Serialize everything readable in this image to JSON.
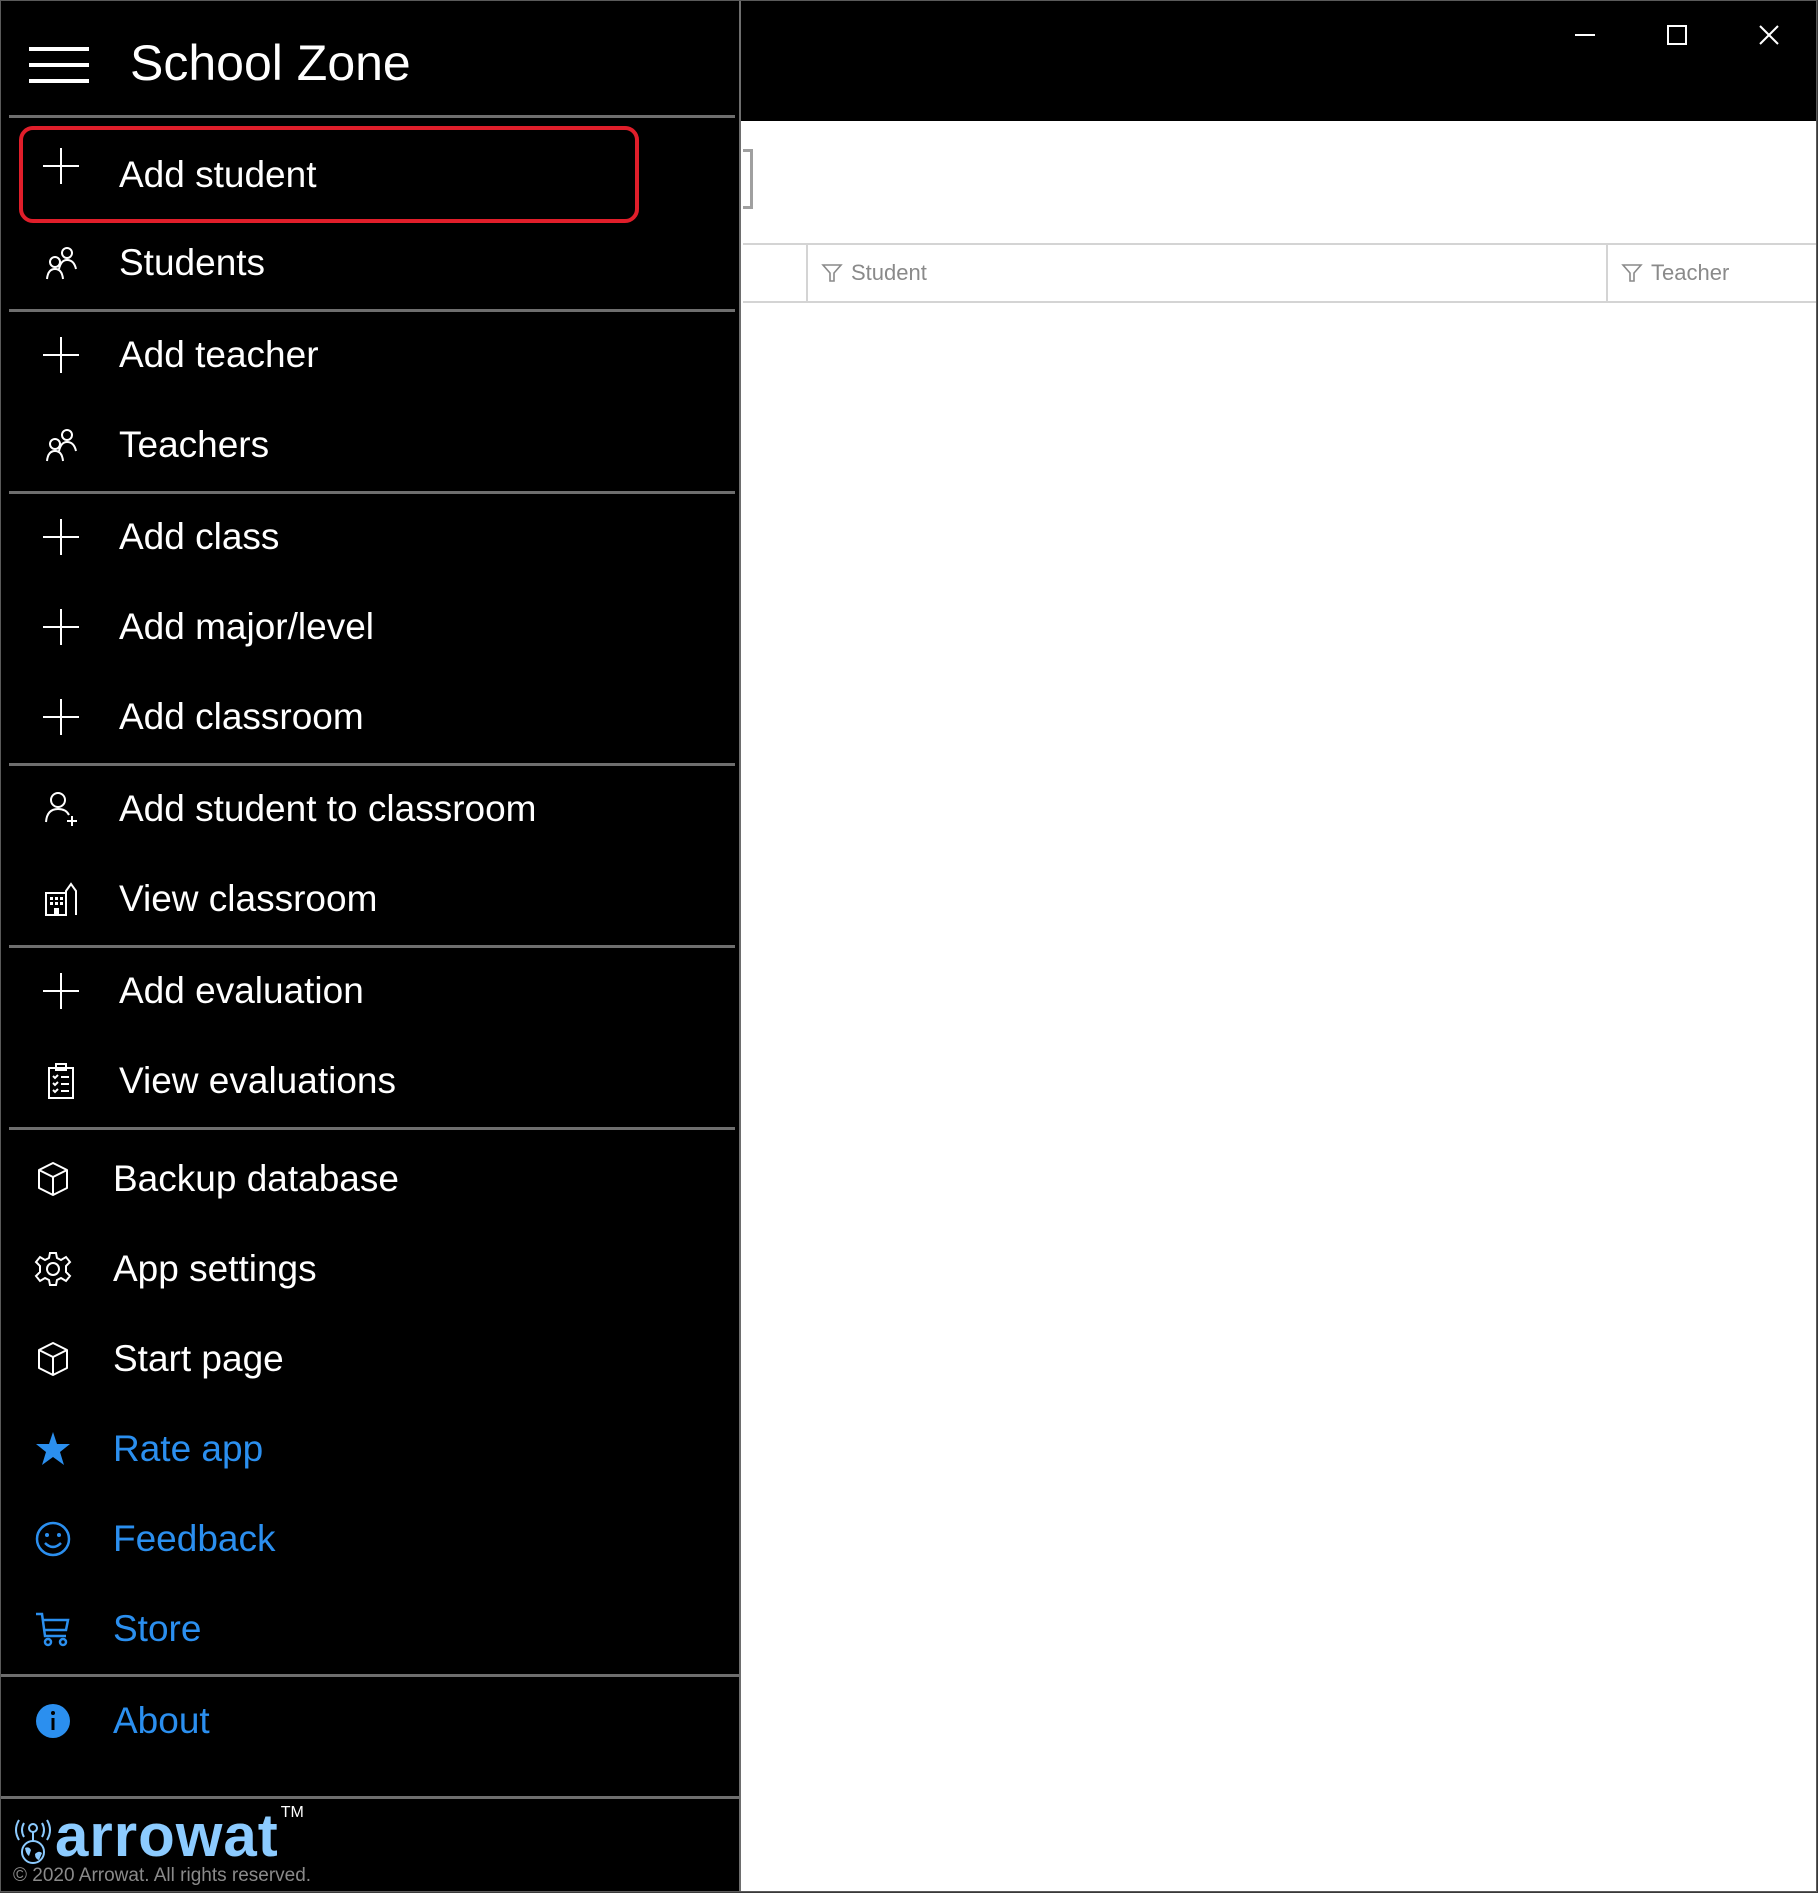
{
  "app": {
    "title": "School Zone"
  },
  "window_controls": {
    "minimize": "minimize-icon",
    "maximize": "maximize-icon",
    "close": "close-icon"
  },
  "nav": {
    "items": [
      {
        "label": "Add student",
        "icon": "plus-icon",
        "selected": true
      },
      {
        "label": "Students",
        "icon": "people-icon"
      },
      {
        "label": "Add teacher",
        "icon": "plus-icon"
      },
      {
        "label": "Teachers",
        "icon": "people-icon"
      },
      {
        "label": "Add class",
        "icon": "plus-icon"
      },
      {
        "label": "Add major/level",
        "icon": "plus-icon"
      },
      {
        "label": "Add classroom",
        "icon": "plus-icon"
      },
      {
        "label": "Add student to classroom",
        "icon": "add-person-icon"
      },
      {
        "label": "View classroom",
        "icon": "building-icon"
      },
      {
        "label": "Add evaluation",
        "icon": "plus-icon"
      },
      {
        "label": "View evaluations",
        "icon": "clipboard-checklist-icon"
      },
      {
        "label": "Backup database",
        "icon": "cube-icon"
      },
      {
        "label": "App settings",
        "icon": "gear-icon"
      },
      {
        "label": "Start page",
        "icon": "cube-icon"
      },
      {
        "label": "Rate app",
        "icon": "star-icon"
      },
      {
        "label": "Feedback",
        "icon": "smiley-icon"
      },
      {
        "label": "Store",
        "icon": "shopping-cart-icon"
      },
      {
        "label": "About",
        "icon": "info-icon"
      }
    ]
  },
  "footer": {
    "brand": "arrowat",
    "trademark": "TM",
    "copyright": "© 2020 Arrowat. All rights reserved."
  },
  "grid": {
    "columns": [
      {
        "label": "Student",
        "icon": "filter-icon"
      },
      {
        "label": "Teacher",
        "icon": "filter-icon"
      }
    ]
  },
  "colors": {
    "accent_blue": "#2b8fef",
    "selection_outline": "#e01e2a",
    "logo_blue": "#8ccbff",
    "sidebar_bg": "#000000"
  }
}
